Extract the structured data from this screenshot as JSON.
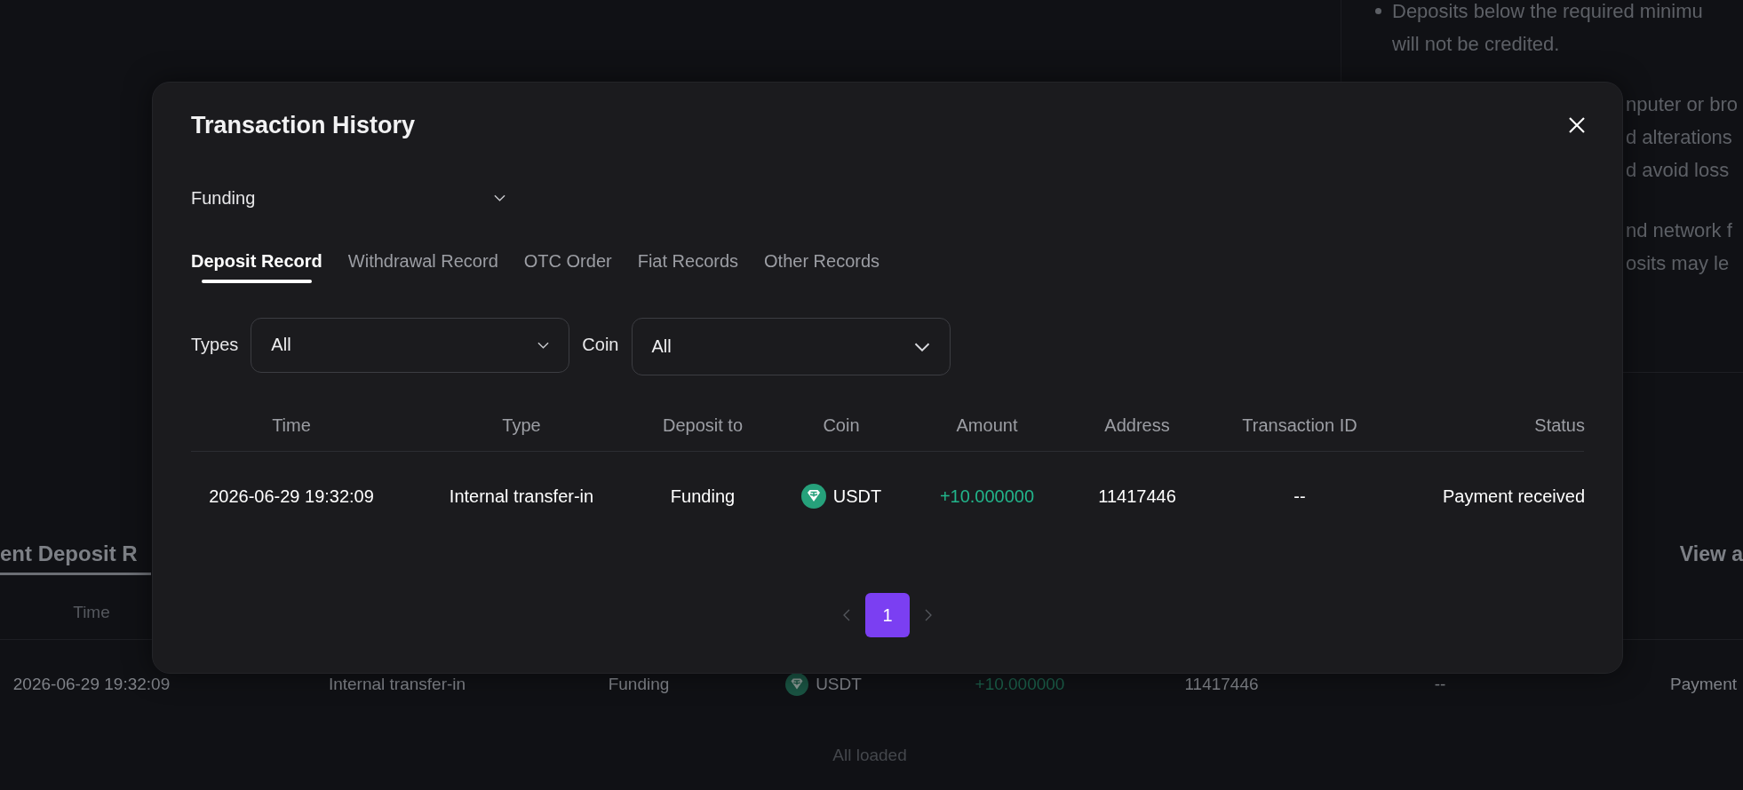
{
  "background_page": {
    "notes": [
      {
        "kind": "bullet",
        "lines": [
          "Deposits below the required minimu",
          "will not be credited."
        ]
      },
      {
        "kind": "fragment",
        "lines": [
          "nputer or bro",
          "d alterations",
          "d avoid loss"
        ]
      },
      {
        "kind": "fragment",
        "lines": [
          "nd network f",
          "osits may le"
        ]
      }
    ],
    "recent_deposits": {
      "title": "ent Deposit R",
      "view_all": "View a",
      "columns": [
        "Time"
      ],
      "rows": [
        {
          "time": "2026-06-29 19:32:09",
          "type": "Internal transfer-in",
          "deposit_to": "Funding",
          "coin": "USDT",
          "amount": "+10.000000",
          "address": "11417446",
          "transaction_id": "--",
          "status": "Payment"
        }
      ],
      "footer": "All loaded"
    }
  },
  "modal": {
    "title": "Transaction History",
    "account_select": {
      "value": "Funding"
    },
    "tabs": [
      {
        "label": "Deposit Record",
        "selected": true
      },
      {
        "label": "Withdrawal Record",
        "selected": false
      },
      {
        "label": "OTC Order",
        "selected": false
      },
      {
        "label": "Fiat Records",
        "selected": false
      },
      {
        "label": "Other Records",
        "selected": false
      }
    ],
    "filters": [
      {
        "label": "Types",
        "value": "All"
      },
      {
        "label": "Coin",
        "value": "All"
      }
    ],
    "table": {
      "columns": [
        "Time",
        "Type",
        "Deposit to",
        "Coin",
        "Amount",
        "Address",
        "Transaction ID",
        "Status"
      ],
      "rows": [
        {
          "time": "2026-06-29 19:32:09",
          "type": "Internal transfer-in",
          "deposit_to": "Funding",
          "coin": "USDT",
          "amount": "+10.000000",
          "address": "11417446",
          "transaction_id": "--",
          "status": "Payment received"
        }
      ]
    },
    "pagination": {
      "pages": [
        {
          "label": "1",
          "selected": true
        }
      ]
    }
  }
}
